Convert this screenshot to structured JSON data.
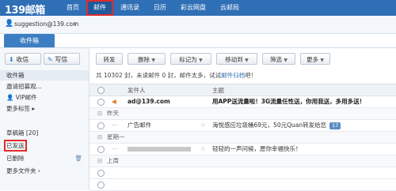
{
  "header": {
    "logo": "139邮箱",
    "nav": [
      "首页",
      "邮件",
      "通讯录",
      "日历",
      "彩云网盘",
      "云邮局"
    ]
  },
  "user": {
    "email": "suggestion@139.com",
    "caret": "∨"
  },
  "tabs": {
    "inbox": "收件箱"
  },
  "sidebar": {
    "receive": "收信",
    "write": "写信",
    "items": [
      {
        "label": "收件箱",
        "extra": ""
      },
      {
        "label": "遨请招募观...",
        "extra": ""
      },
      {
        "label": "VIP邮件",
        "extra": ""
      },
      {
        "label": "更多标签",
        "extra": "▸"
      },
      {
        "label": "草稿箱 [20]",
        "extra": ""
      },
      {
        "label": "已发送",
        "extra": ""
      },
      {
        "label": "已删除",
        "extra": ""
      },
      {
        "label": "更多文件夹",
        "extra": ""
      }
    ]
  },
  "toolbar": {
    "buttons": [
      "转发",
      "删除",
      "标记为",
      "移动到",
      "筛选",
      "更多"
    ]
  },
  "stats": {
    "text": "共 10302 封，未读邮件 0 封，邮件太多，试试",
    "link": "邮件归档",
    "tail": "吧！"
  },
  "table": {
    "col_from": "发件人",
    "col_subject": "主题"
  },
  "rows": [
    {
      "type": "mail",
      "from": "ad@139.com",
      "subject": "用APP送流量啦！3G流量任性送，你用我送，多用多送！",
      "bold": true
    },
    {
      "type": "section",
      "label": "昨天"
    },
    {
      "type": "mail",
      "from": "广告邮件",
      "subject": "海悦感应垃圾桶69元，50元Quan转发给您",
      "badge": "17"
    },
    {
      "type": "section",
      "label": "星期一"
    },
    {
      "type": "mail",
      "from": "",
      "subject": "轻轻的一声问候，愿你幸福快乐！"
    },
    {
      "type": "section",
      "label": "上周"
    }
  ],
  "colors": {
    "topbar": "#2f6fb6",
    "highlight": "#e02a2a"
  }
}
